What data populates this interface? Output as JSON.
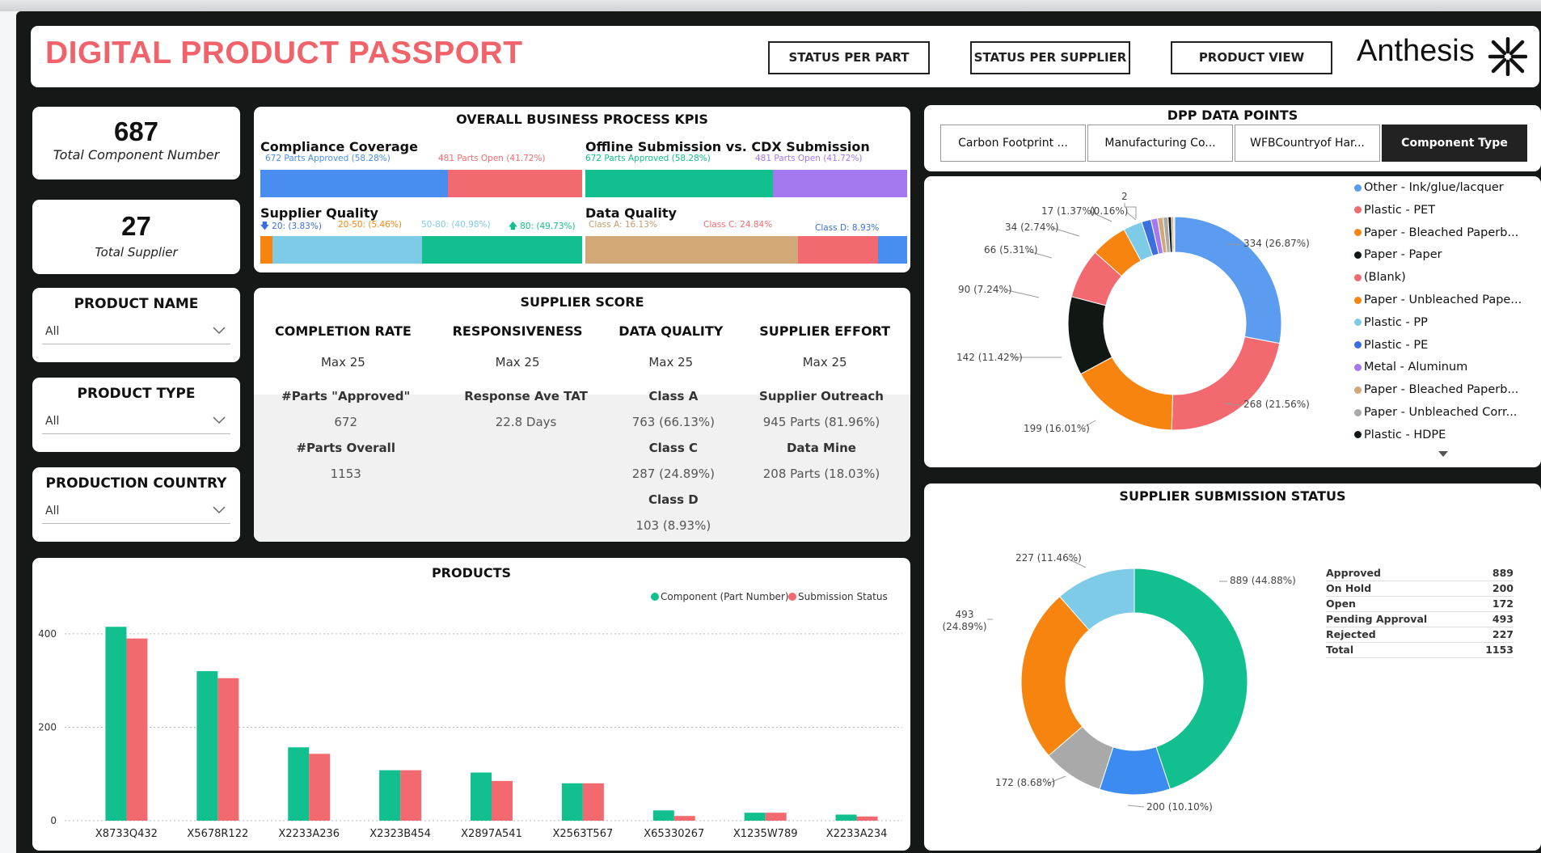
{
  "header": {
    "title": "DIGITAL PRODUCT PASSPORT",
    "nav": [
      "STATUS PER PART",
      "STATUS PER SUPPLIER",
      "PRODUCT VIEW"
    ],
    "brand": "Anthesis",
    "title_color": "#f0636b"
  },
  "kpis": {
    "components": {
      "value": "687",
      "label": "Total Component Number"
    },
    "suppliers": {
      "value": "27",
      "label": "Total Supplier"
    }
  },
  "filters": [
    {
      "title": "PRODUCT NAME",
      "value": "All"
    },
    {
      "title": "PRODUCT TYPE",
      "value": "All"
    },
    {
      "title": "PRODUCTION COUNTRY",
      "value": "All"
    }
  ],
  "business_kpis": {
    "title": "OVERALL BUSINESS PROCESS KPIS",
    "compliance": {
      "title": "Compliance Coverage",
      "approved": "672 Parts Approved (58.28%)",
      "open": "481 Parts Open (41.72%)",
      "approved_share": 58.28,
      "open_share": 41.72
    },
    "offline": {
      "title": "Offline Submission vs. CDX Submission",
      "approved": "672 Parts Approved (58.28%)",
      "open": "481 Parts Open (41.72%)",
      "approved_share": 58.28,
      "open_share": 41.72
    },
    "supplier_quality": {
      "title": "Supplier Quality",
      "labels": [
        "20: (3.83%)",
        "20-50: (5.46%)",
        "50-80: (40.98%)",
        "80: (49.73%)"
      ],
      "shares": [
        3.83,
        5.46,
        40.98,
        49.73
      ]
    },
    "data_quality": {
      "title": "Data Quality",
      "labels": [
        "Class A: 16.13%",
        "Class C: 24.84%",
        "Class D: 8.93%"
      ],
      "shares": [
        66.13,
        24.89,
        8.93
      ]
    }
  },
  "supplier_score": {
    "title": "SUPPLIER SCORE",
    "columns": [
      "COMPLETION RATE",
      "RESPONSIVENESS",
      "DATA QUALITY",
      "SUPPLIER EFFORT"
    ],
    "max": [
      "Max 25",
      "Max 25",
      "Max 25",
      "Max 25"
    ],
    "rows": [
      [
        "#Parts \"Approved\"",
        "Response Ave TAT",
        "Class A",
        "Supplier Outreach"
      ],
      [
        "672",
        "22.8 Days",
        "763 (66.13%)",
        "945 Parts (81.96%)"
      ],
      [
        "#Parts Overall",
        "",
        "Class C",
        "Data Mine"
      ],
      [
        "1153",
        "",
        "287 (24.89%)",
        "208 Parts (18.03%)"
      ],
      [
        "",
        "",
        "Class D",
        ""
      ],
      [
        "",
        "",
        "103 (8.93%)",
        ""
      ]
    ]
  },
  "dpp": {
    "title": "DPP DATA POINTS",
    "tabs": [
      "Carbon Footprint ...",
      "Manufacturing Co...",
      "WFBCountryof Har...",
      "Component Type"
    ],
    "legend": [
      "Other - Ink/glue/lacquer",
      "Plastic - PET",
      "Paper - Bleached Paperb...",
      "Paper - Paper",
      "(Blank)",
      "Paper - Unbleached Pape...",
      "Plastic - PP",
      "Plastic - PE",
      "Metal - Aluminum",
      "Paper - Bleached Paperb...",
      "Paper - Unbleached Corr...",
      "Plastic - HDPE"
    ]
  },
  "supplier_status": {
    "title": "SUPPLIER SUBMISSION STATUS",
    "table": [
      {
        "label": "Approved",
        "value": "889"
      },
      {
        "label": "On Hold",
        "value": "200"
      },
      {
        "label": "Open",
        "value": "172"
      },
      {
        "label": "Pending Approval",
        "value": "493"
      },
      {
        "label": "Rejected",
        "value": "227"
      },
      {
        "label": "Total",
        "value": "1153"
      }
    ]
  },
  "colors": {
    "blue": "#4a8df0",
    "red": "#f26a6f",
    "green": "#11c08e",
    "purple": "#a678f0",
    "lightblue": "#7ecbe8",
    "orange": "#f88410",
    "tan": "#d2a878",
    "black": "#111814",
    "grey": "#a9a9a9"
  },
  "chart_data": [
    {
      "type": "pie",
      "title": "",
      "donut": true,
      "slices": [
        {
          "label": "Other - Ink/glue/lacquer",
          "value": 334,
          "text": "334 (26.87%)",
          "color": "#5b9bf0"
        },
        {
          "label": "Plastic - PET",
          "value": 268,
          "text": "268 (21.56%)",
          "color": "#f26a6f"
        },
        {
          "label": "Paper - Bleached Paperb...",
          "value": 199,
          "text": "199 (16.01%)",
          "color": "#f88410"
        },
        {
          "label": "Paper - Paper",
          "value": 142,
          "text": "142 (11.42%)",
          "color": "#111814"
        },
        {
          "label": "(Blank)",
          "value": 90,
          "text": "90 (7.24%)",
          "color": "#f26a6f"
        },
        {
          "label": "Paper - Unbleached Pape...",
          "value": 66,
          "text": "66 (5.31%)",
          "color": "#f88410"
        },
        {
          "label": "Plastic - PP",
          "value": 34,
          "text": "34 (2.74%)",
          "color": "#7ecbe8"
        },
        {
          "label": "Plastic - PE",
          "value": 17,
          "text": "17 (1.37%)",
          "color": "#3b6fe0"
        },
        {
          "label": "Metal - Aluminum",
          "value": 12,
          "text": "",
          "color": "#a678f0"
        },
        {
          "label": "Paper - Bleached Paperb...",
          "value": 10,
          "text": "",
          "color": "#d2a878"
        },
        {
          "label": "Paper - Unbleached Corr...",
          "value": 9,
          "text": "",
          "color": "#a9a9a9"
        },
        {
          "label": "Plastic - HDPE",
          "value": 6,
          "text": "",
          "color": "#111814"
        },
        {
          "label": "",
          "value": 4,
          "text": "",
          "color": "#d2a878"
        },
        {
          "label": "",
          "value": 2,
          "text": "2 (0.16%)",
          "color": "#7ecbe8"
        }
      ]
    },
    {
      "type": "pie",
      "title": "",
      "donut": true,
      "slices": [
        {
          "label": "Approved",
          "value": 889,
          "text": "889 (44.88%)",
          "color": "#11c08e"
        },
        {
          "label": "On Hold",
          "value": 200,
          "text": "200 (10.10%)",
          "color": "#3b8bf0"
        },
        {
          "label": "Open",
          "value": 172,
          "text": "172 (8.68%)",
          "color": "#a9a9a9"
        },
        {
          "label": "Pending Approval",
          "value": 493,
          "text": "493 (24.89%)",
          "color": "#f88410"
        },
        {
          "label": "Rejected",
          "value": 227,
          "text": "227 (11.46%)",
          "color": "#7ecbe8"
        }
      ]
    },
    {
      "type": "bar",
      "title": "PRODUCTS",
      "categories": [
        "X8733Q432",
        "X5678R122",
        "X2233A236",
        "X2323B454",
        "X2897A541",
        "X2563T567",
        "X65330267",
        "X1235W789",
        "X2233A234"
      ],
      "series": [
        {
          "name": "Component (Part Number)",
          "color": "#11c08e",
          "values": [
            415,
            320,
            157,
            108,
            103,
            80,
            22,
            17,
            13
          ]
        },
        {
          "name": "Submission Status",
          "color": "#f26a6f",
          "values": [
            390,
            305,
            143,
            108,
            85,
            80,
            10,
            17,
            9
          ]
        }
      ],
      "yticks": [
        "0",
        "200",
        "400"
      ],
      "ylim": [
        0,
        450
      ],
      "legend": "top-right"
    }
  ]
}
